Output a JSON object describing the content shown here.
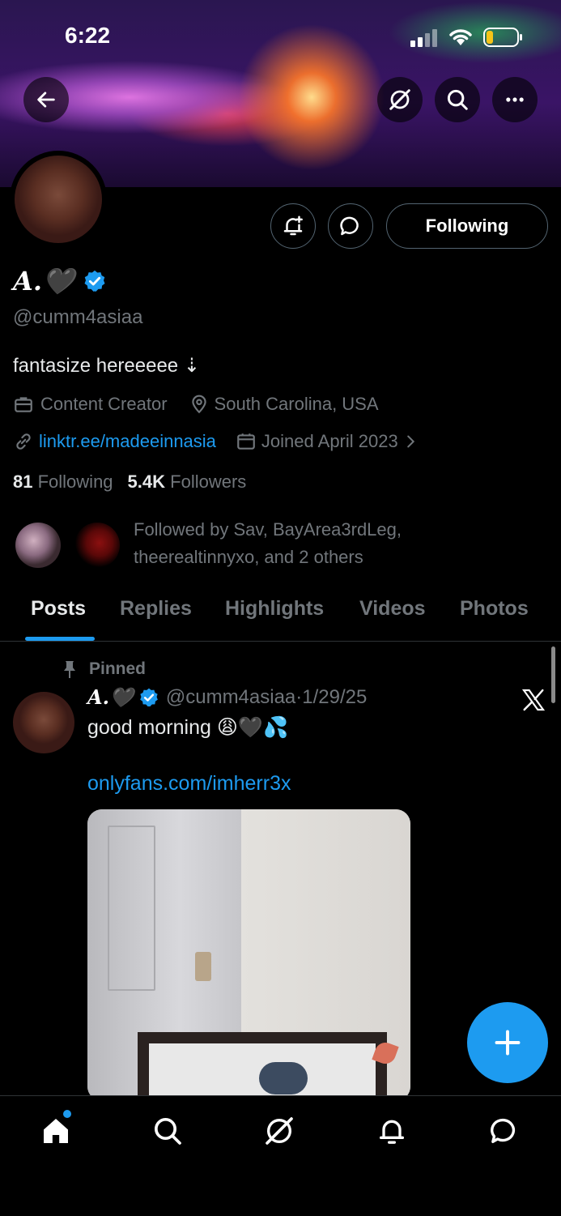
{
  "status": {
    "time": "6:22"
  },
  "profile": {
    "name": "A.🖤",
    "handle": "@cumm4asiaa",
    "bio": "fantasize hereeeee ⇣",
    "category": "Content Creator",
    "location": "South Carolina, USA",
    "link": "linktr.ee/madeeinnasia",
    "joined": "Joined April 2023",
    "following_count": "81",
    "following_label": "Following",
    "followers_count": "5.4K",
    "followers_label": "Followers",
    "followed_by_line1": "Followed by Sav, BayArea3rdLeg,",
    "followed_by_line2": "theerealtinnyxo, and 2 others",
    "follow_button": "Following"
  },
  "tabs": [
    "Posts",
    "Replies",
    "Highlights",
    "Videos",
    "Photos"
  ],
  "pinned_post": {
    "pinned_label": "Pinned",
    "author_name": "A.🖤",
    "author_handle": "@cumm4asiaa",
    "date": "·1/29/25",
    "text": "good morning 😩🖤💦",
    "link": "onlyfans.com/imherr3x"
  },
  "colors": {
    "accent": "#1d9bf0",
    "background": "#000000",
    "muted": "#71767b"
  }
}
